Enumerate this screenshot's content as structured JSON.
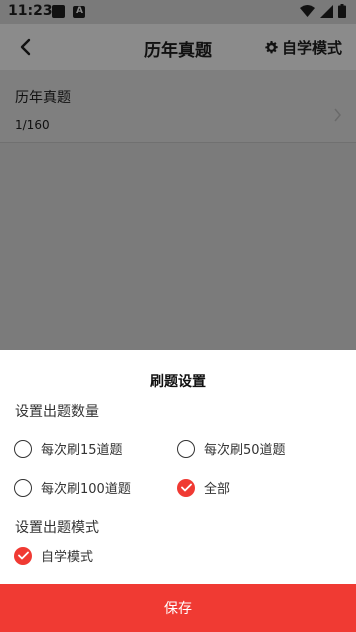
{
  "status_bar": {
    "time": "11:23"
  },
  "header": {
    "title": "历年真题",
    "mode_label": "自学模式",
    "back_icon": "chevron-left-icon",
    "mode_icon": "gear-icon"
  },
  "list": [
    {
      "title": "历年真题",
      "count": "1/160"
    }
  ],
  "sheet": {
    "title": "刷题设置",
    "quantity_label": "设置出题数量",
    "quantity_options": [
      {
        "label": "每次刷15道题",
        "checked": false
      },
      {
        "label": "每次刷50道题",
        "checked": false
      },
      {
        "label": "每次刷100道题",
        "checked": false
      },
      {
        "label": "全部",
        "checked": true
      }
    ],
    "mode_label": "设置出题模式",
    "mode_options": [
      {
        "label": "自学模式",
        "checked": true
      }
    ],
    "accent_color": "#f03a33"
  },
  "footer": {
    "save_label": "保存"
  }
}
